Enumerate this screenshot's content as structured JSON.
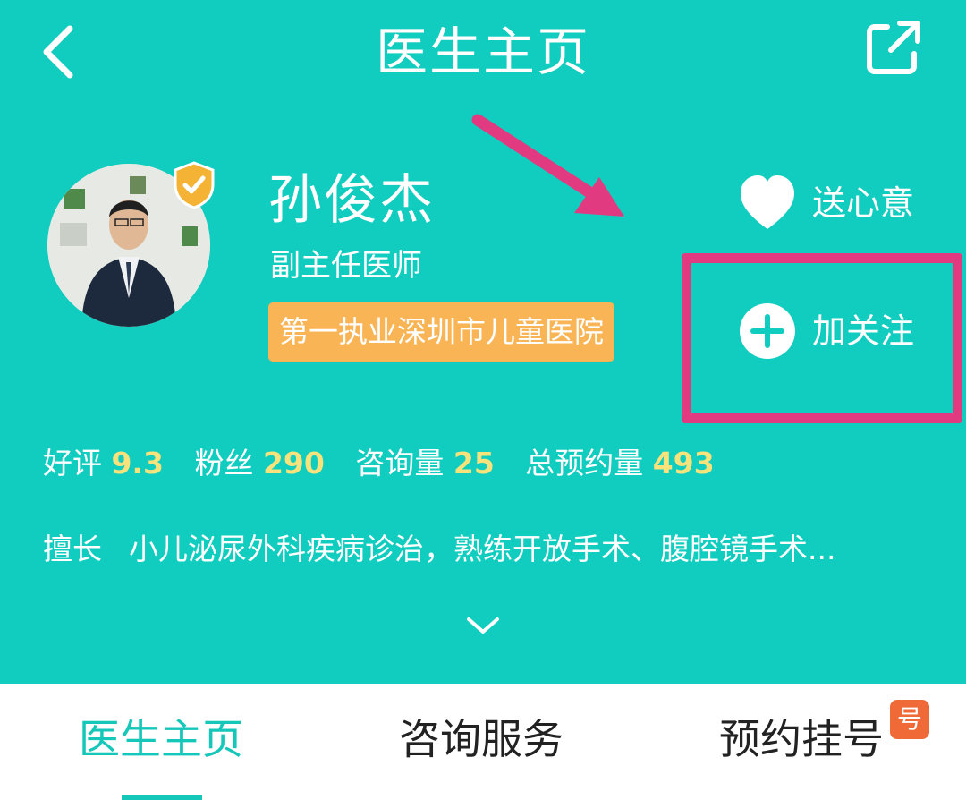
{
  "header": {
    "title": "医生主页",
    "back_icon": "chevron-left-icon",
    "share_icon": "share-external-icon"
  },
  "doctor": {
    "name": "孙俊杰",
    "title": "副主任医师",
    "hospital": "第一执业深圳市儿童医院",
    "verified_icon": "verified-shield-icon"
  },
  "actions": {
    "gift_label": "送心意",
    "gift_icon": "heart-icon",
    "follow_label": "加关注",
    "follow_icon": "plus-circle-icon"
  },
  "stats": [
    {
      "label": "好评",
      "value": "9.3"
    },
    {
      "label": "粉丝",
      "value": "290"
    },
    {
      "label": "咨询量",
      "value": "25"
    },
    {
      "label": "总预约量",
      "value": "493"
    }
  ],
  "specialty": {
    "label": "擅长",
    "text": "小儿泌尿外科疾病诊治，熟练开放手术、腹腔镜手术..."
  },
  "tabs": [
    {
      "label": "医生主页"
    },
    {
      "label": "咨询服务"
    },
    {
      "label": "预约挂号",
      "badge": "号"
    }
  ],
  "colors": {
    "primary": "#11cdbf",
    "accent_value": "#f7e27c",
    "tag_bg": "#f9b456",
    "highlight": "#e23a80",
    "badge": "#ef6a36"
  }
}
